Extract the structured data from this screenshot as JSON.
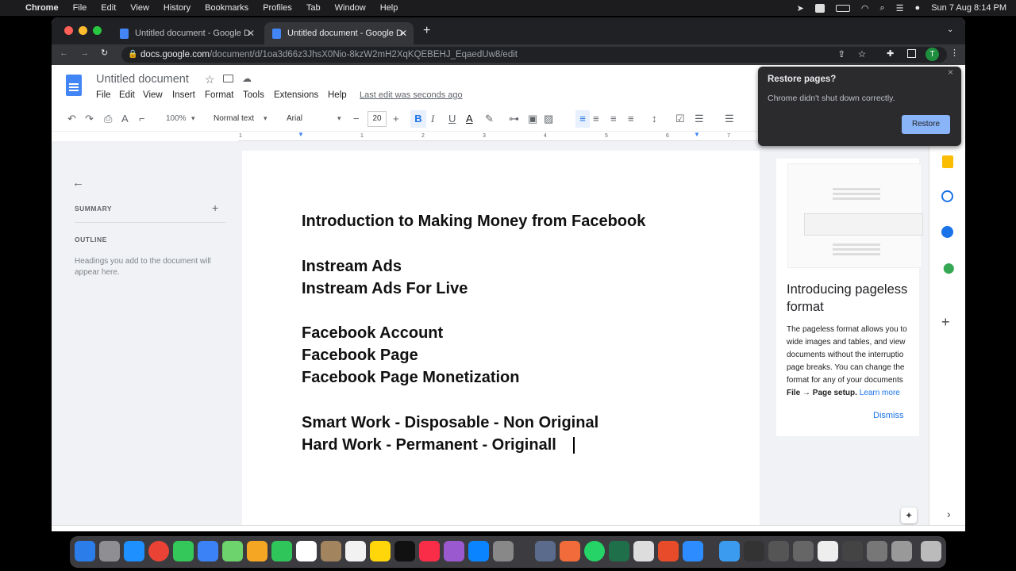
{
  "menubar": {
    "app": "Chrome",
    "items": [
      "File",
      "Edit",
      "View",
      "History",
      "Bookmarks",
      "Profiles",
      "Tab",
      "Window",
      "Help"
    ],
    "clock": "Sun 7 Aug  8:14 PM"
  },
  "tabs": [
    {
      "title": "Untitled document - Google D",
      "active": false
    },
    {
      "title": "Untitled document - Google D",
      "active": true
    }
  ],
  "omnibox": {
    "host": "docs.google.com",
    "path": "/document/d/1oa3d66z3JhsX0Nio-8kzW2mH2XqKQEBEHJ_EqaedUw8/edit"
  },
  "profile_initial": "T",
  "doc": {
    "title": "Untitled document",
    "menus": [
      "File",
      "Edit",
      "View",
      "Insert",
      "Format",
      "Tools",
      "Extensions",
      "Help"
    ],
    "last_edit": "Last edit was seconds ago",
    "toolbar": {
      "zoom": "100%",
      "style": "Normal text",
      "font": "Arial",
      "size": "20"
    },
    "ruler_marks": [
      "1",
      "1",
      "2",
      "3",
      "4",
      "5",
      "6",
      "7"
    ],
    "lines": [
      "Introduction to Making Money from Facebook",
      "Instream Ads",
      "Instream Ads For Live",
      "Facebook Account",
      "Facebook Page",
      "Facebook Page Monetization",
      "Smart Work - Disposable - Non Original",
      "Hard Work - Permanent - Originall"
    ]
  },
  "outline_panel": {
    "summary": "SUMMARY",
    "outline": "OUTLINE",
    "hint": "Headings you add to the document will appear here."
  },
  "pageless_card": {
    "title": "Introducing pageless format",
    "body_lines": [
      "The pageless format allows you to",
      "wide images and tables, and view",
      "documents without the interruptio",
      "page breaks. You can change the",
      "format for any of your documents"
    ],
    "menu_path": "File → Page setup.",
    "learn_more": "Learn more",
    "dismiss": "Dismiss"
  },
  "restore_popup": {
    "title": "Restore pages?",
    "message": "Chrome didn't shut down correctly.",
    "button": "Restore"
  },
  "colors": {
    "accent": "#4285f4",
    "restore_btn": "#8ab4f8"
  }
}
